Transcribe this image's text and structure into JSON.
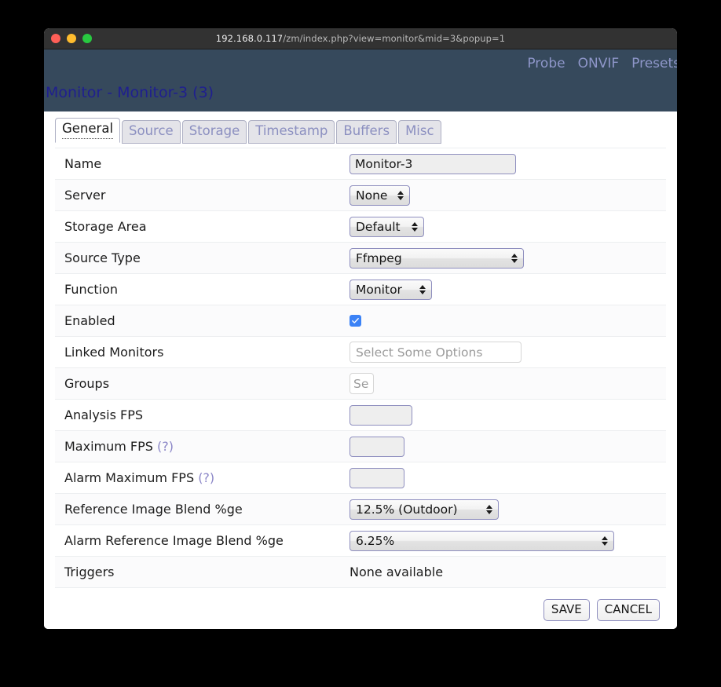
{
  "browser": {
    "url_host": "192.168.0.117",
    "url_path": "/zm/index.php?view=monitor&mid=3&popup=1",
    "traffic_lights": [
      "close-button",
      "minimize-button",
      "maximize-button"
    ]
  },
  "header": {
    "title": "Monitor - Monitor-3 (3)",
    "nav": [
      {
        "label": "Probe"
      },
      {
        "label": "ONVIF"
      },
      {
        "label": "Presets"
      }
    ]
  },
  "tabs": [
    {
      "label": "General",
      "active": true
    },
    {
      "label": "Source",
      "active": false
    },
    {
      "label": "Storage",
      "active": false
    },
    {
      "label": "Timestamp",
      "active": false
    },
    {
      "label": "Buffers",
      "active": false
    },
    {
      "label": "Misc",
      "active": false
    }
  ],
  "form": {
    "name": {
      "label": "Name",
      "value": "Monitor-3"
    },
    "server": {
      "label": "Server",
      "value": "None"
    },
    "storage_area": {
      "label": "Storage Area",
      "value": "Default"
    },
    "source_type": {
      "label": "Source Type",
      "value": "Ffmpeg"
    },
    "function": {
      "label": "Function",
      "value": "Monitor"
    },
    "enabled": {
      "label": "Enabled",
      "checked": true
    },
    "linked_monitors": {
      "label": "Linked Monitors",
      "value": "",
      "placeholder": "Select Some Options"
    },
    "groups": {
      "label": "Groups",
      "value": "",
      "placeholder": "Se"
    },
    "analysis_fps": {
      "label": "Analysis FPS",
      "value": ""
    },
    "maximum_fps": {
      "label": "Maximum FPS",
      "hint": "(?)",
      "value": ""
    },
    "alarm_maximum_fps": {
      "label": "Alarm Maximum FPS",
      "hint": "(?)",
      "value": ""
    },
    "ref_image_blend": {
      "label": "Reference Image Blend %ge",
      "value": "12.5% (Outdoor)"
    },
    "alarm_ref_image_blend": {
      "label": "Alarm Reference Image Blend %ge",
      "value": "6.25%"
    },
    "triggers": {
      "label": "Triggers",
      "value": "None available"
    }
  },
  "buttons": {
    "save": "SAVE",
    "cancel": "CANCEL"
  },
  "colors": {
    "header_bg": "#36495c",
    "title_text": "#1f1f8f",
    "nav_link": "#8e96c9",
    "tab_inactive_text": "#8b8fc0",
    "input_border": "#8f8fbf",
    "checkbox": "#3b82f6",
    "titlebar_bg": "#323232"
  }
}
